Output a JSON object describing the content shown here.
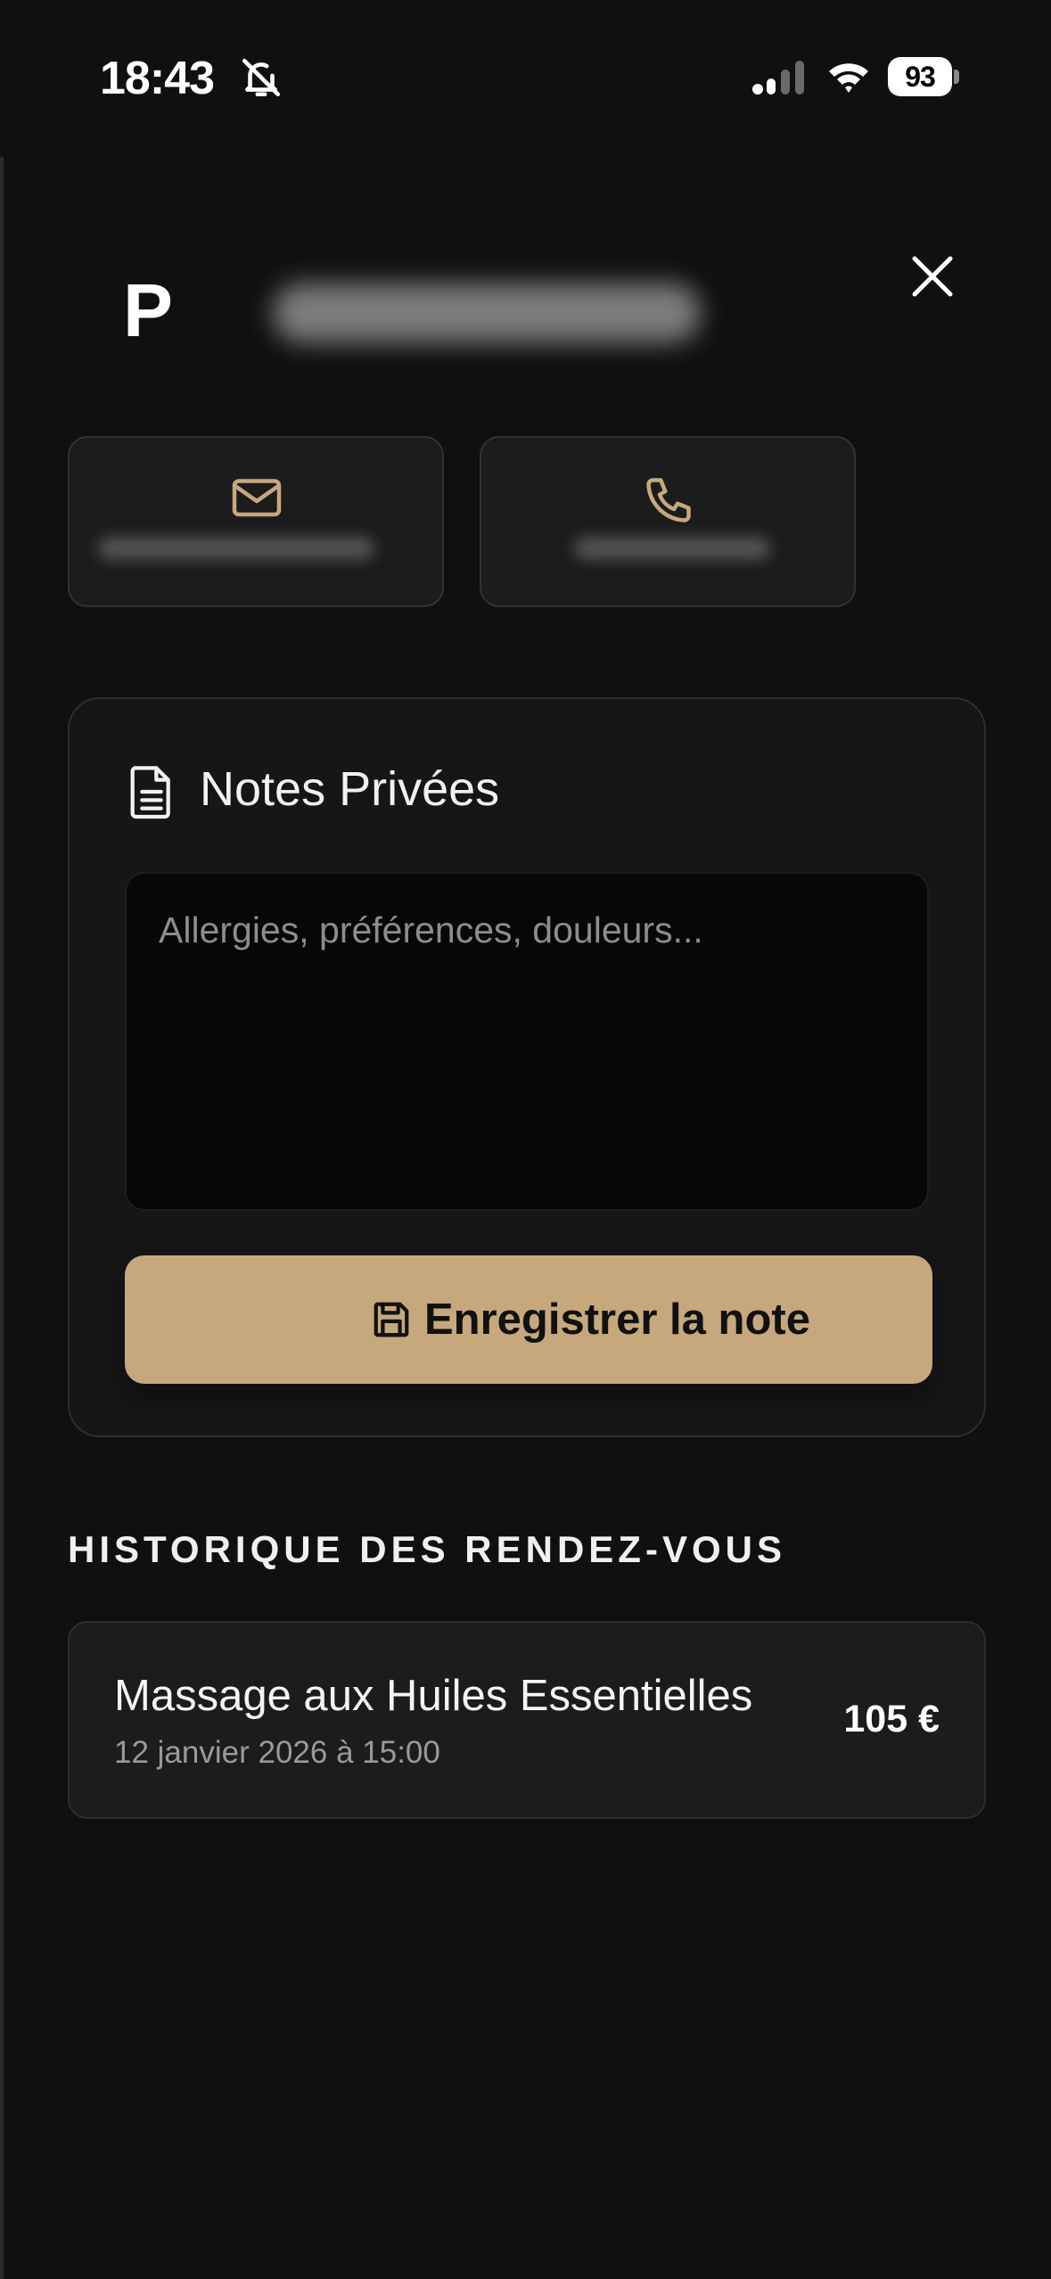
{
  "status_bar": {
    "time": "18:43",
    "battery": "93",
    "icons": [
      "bell-slash-icon",
      "signal-icon",
      "wifi-icon",
      "battery-icon"
    ]
  },
  "client": {
    "initial": "P"
  },
  "contact": {
    "email_icon": "mail-icon",
    "phone_icon": "phone-icon"
  },
  "notes": {
    "title": "Notes Privées",
    "placeholder": "Allergies, préférences, douleurs...",
    "value": "",
    "save_label": "Enregistrer la note"
  },
  "history": {
    "title": "HISTORIQUE DES RENDEZ-VOUS",
    "items": [
      {
        "service": "Massage aux Huiles Essentielles",
        "date": "12 janvier 2026 à 15:00",
        "price": "105 €"
      }
    ]
  },
  "colors": {
    "background": "#101010",
    "card": "#1c1c1c",
    "accent": "#c6a87c",
    "textarea": "#070707"
  }
}
